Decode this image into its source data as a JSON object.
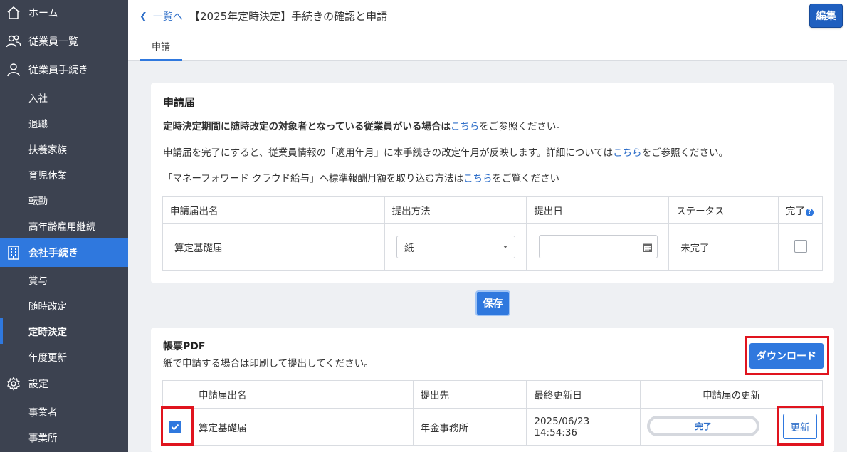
{
  "sidebar": {
    "home": "ホーム",
    "employees": "従業員一覧",
    "employee_procedures": "従業員手続き",
    "employee_sub": [
      "入社",
      "退職",
      "扶養家族",
      "育児休業",
      "転勤",
      "高年齢雇用継続"
    ],
    "company_procedures": "会社手続き",
    "company_sub": [
      "賞与",
      "随時改定",
      "定時決定",
      "年度更新"
    ],
    "settings": "設定",
    "settings_sub": [
      "事業者",
      "事業所"
    ]
  },
  "header": {
    "back_label": "一覧へ",
    "title": "【2025年定時決定】手続きの確認と申請",
    "edit_label": "編集",
    "tab_label": "申請"
  },
  "application": {
    "title": "申請届",
    "note1_bold": "定時決定期間に随時改定の対象者となっている従業員がいる場合は",
    "note1_link": "こちら",
    "note1_tail": "をご参照ください。",
    "note2_pre": "申請届を完了にすると、従業員情報の「適用年月」に本手続きの改定年月が反映します。詳細については",
    "note2_link": "こちら",
    "note2_tail": "をご参照ください。",
    "note3_pre": "「マネーフォワード クラウド給与」へ標準報酬月額を取り込む方法は",
    "note3_link": "こちら",
    "note3_tail": "をご覧ください",
    "columns": [
      "申請届出名",
      "提出方法",
      "提出日",
      "ステータス",
      "完了"
    ],
    "row": {
      "name": "算定基礎届",
      "method": "紙",
      "date": "",
      "status": "未完了"
    },
    "save_label": "保存"
  },
  "pdf": {
    "title": "帳票PDF",
    "subtitle": "紙で申請する場合は印刷して提出してください。",
    "download_label": "ダウンロード",
    "columns": [
      "申請届出名",
      "提出先",
      "最終更新日",
      "申請届の更新"
    ],
    "row": {
      "name": "算定基礎届",
      "destination": "年金事務所",
      "updated": "2025/06/23 14:54:36",
      "status": "完了",
      "update_label": "更新"
    }
  },
  "colors": {
    "accent": "#2f78de",
    "sidebar_bg": "#3c4250",
    "highlight": "#e0141e"
  }
}
